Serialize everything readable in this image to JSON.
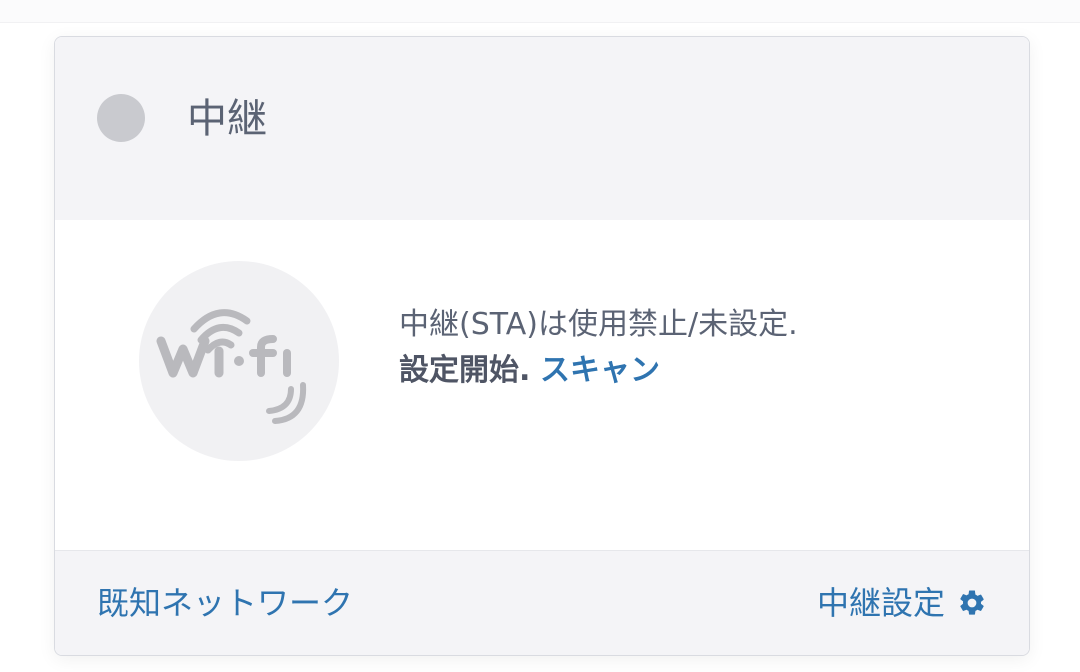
{
  "card": {
    "title": "中継",
    "status": "inactive",
    "status_color": "#c9cacf",
    "message": {
      "text": "中継(STA)は使用禁止/未設定.",
      "start_label": "設定開始.",
      "scan_label": "スキャン"
    },
    "illustration": "wifi-logo",
    "footer": {
      "known_networks_label": "既知ネットワーク",
      "repeater_settings_label": "中継設定",
      "settings_icon": "gear-icon"
    }
  },
  "colors": {
    "link": "#2f74b0",
    "text": "#5b6374",
    "header_bg": "#f4f4f7"
  }
}
